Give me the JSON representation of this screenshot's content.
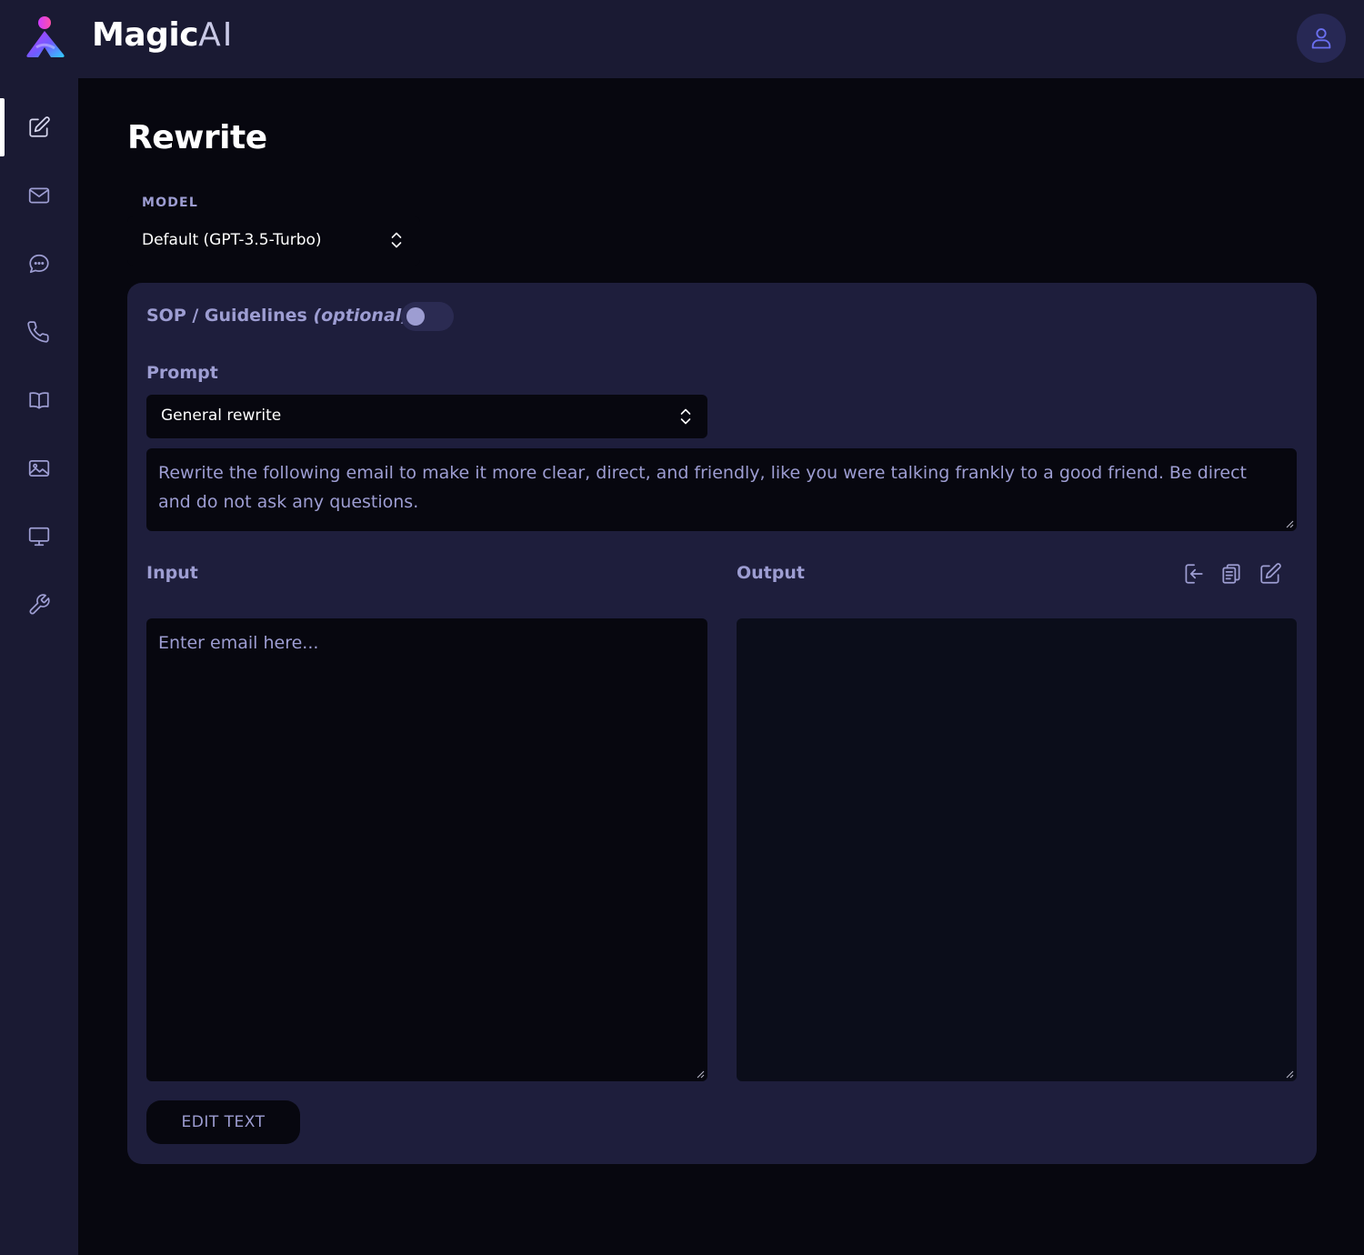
{
  "app": {
    "brand_bold": "Magic",
    "brand_light": "AI"
  },
  "sidebar": {
    "items": [
      {
        "icon": "pencil-square-icon",
        "active": true
      },
      {
        "icon": "envelope-icon",
        "active": false
      },
      {
        "icon": "chat-bubble-icon",
        "active": false
      },
      {
        "icon": "phone-icon",
        "active": false
      },
      {
        "icon": "book-icon",
        "active": false
      },
      {
        "icon": "image-icon",
        "active": false
      },
      {
        "icon": "monitor-icon",
        "active": false
      },
      {
        "icon": "wrench-icon",
        "active": false
      }
    ]
  },
  "header": {
    "user_icon": "user-icon"
  },
  "page": {
    "title": "Rewrite",
    "model_label": "MODEL",
    "model_value": "Default (GPT-3.5-Turbo)"
  },
  "card": {
    "sop_label": "SOP / Guidelines",
    "sop_optional": "(optional)",
    "sop_enabled": false,
    "prompt_label": "Prompt",
    "prompt_value": "General rewrite",
    "prompt_text": "Rewrite the following email to make it more clear, direct, and friendly, like you were talking frankly to a good friend. Be direct and do not ask any questions.",
    "input_label": "Input",
    "input_placeholder": "Enter email here...",
    "output_label": "Output",
    "output_value": "",
    "output_tools": [
      "insert-icon",
      "copy-icon",
      "edit-icon"
    ],
    "edit_button": "EDIT TEXT"
  },
  "colors": {
    "accent": "#9d9dd2",
    "panel": "#1e1e3c",
    "chrome": "#1a1a33",
    "background": "#07070f",
    "user_icon": "#6a6ff0"
  }
}
